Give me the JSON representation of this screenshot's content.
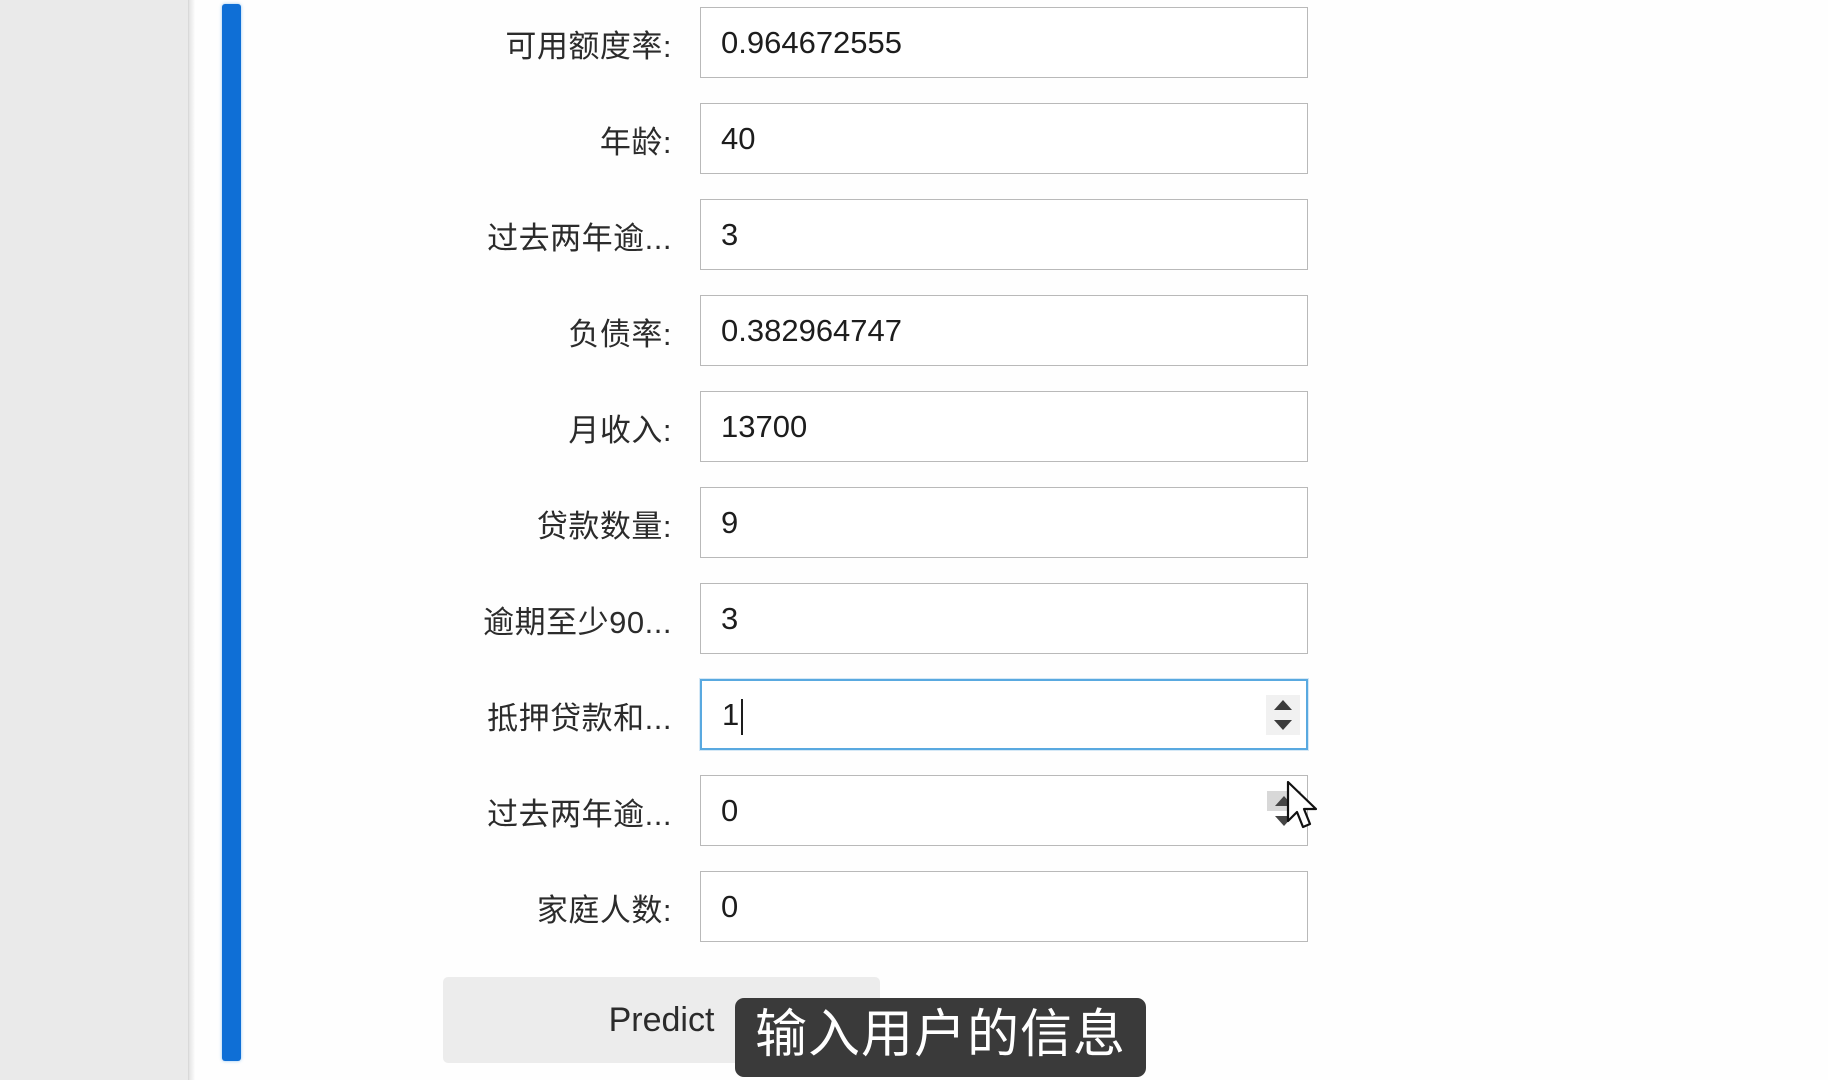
{
  "app": {
    "accent_color": "#0f6fd6",
    "sidebar_color": "#eaeaea",
    "focus_border_color": "#59a9e0"
  },
  "form": {
    "rows": [
      {
        "label": "可用额度率:",
        "value": "0.964672555",
        "type": "text",
        "state": "normal"
      },
      {
        "label": "年龄:",
        "value": "40",
        "type": "text",
        "state": "normal"
      },
      {
        "label": "过去两年逾...",
        "value": "3",
        "type": "text",
        "state": "normal"
      },
      {
        "label": "负债率:",
        "value": "0.382964747",
        "type": "text",
        "state": "normal"
      },
      {
        "label": "月收入:",
        "value": "13700",
        "type": "text",
        "state": "normal"
      },
      {
        "label": "贷款数量:",
        "value": "9",
        "type": "text",
        "state": "normal"
      },
      {
        "label": "逾期至少90...",
        "value": "3",
        "type": "text",
        "state": "normal"
      },
      {
        "label": "抵押贷款和...",
        "value": "1",
        "type": "number",
        "state": "focused"
      },
      {
        "label": "过去两年逾...",
        "value": "0",
        "type": "number",
        "state": "hovered"
      },
      {
        "label": "家庭人数:",
        "value": "0",
        "type": "text",
        "state": "normal"
      }
    ]
  },
  "actions": {
    "predict_label": "Predict"
  },
  "caption": {
    "text": "输入用户的信息"
  },
  "icons": {
    "spinner_up": "spinner-up-arrow-icon",
    "spinner_down": "spinner-down-arrow-icon",
    "mouse": "mouse-pointer-cursor"
  }
}
